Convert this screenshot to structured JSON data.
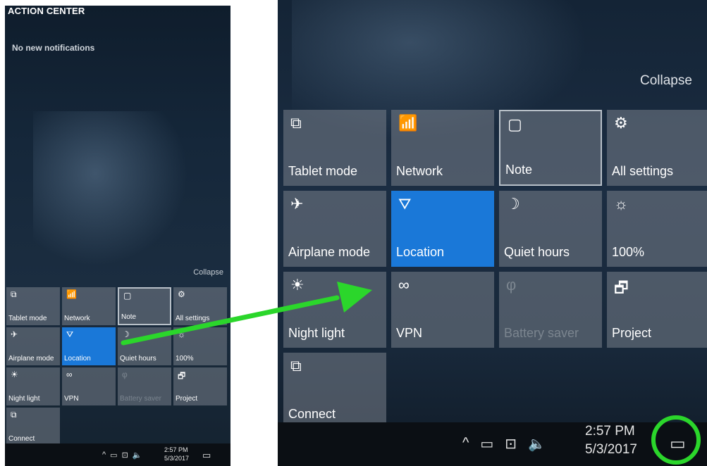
{
  "small_panel": {
    "title": "ACTION CENTER",
    "no_notifications": "No new notifications",
    "collapse_label": "Collapse",
    "tiles": [
      {
        "label": "Tablet mode",
        "icon": "tablet-mode-icon",
        "glyph": "⧉",
        "state": "normal"
      },
      {
        "label": "Network",
        "icon": "network-icon",
        "glyph": "📶",
        "state": "normal"
      },
      {
        "label": "Note",
        "icon": "note-icon",
        "glyph": "▢",
        "state": "outlined"
      },
      {
        "label": "All settings",
        "icon": "gear-icon",
        "glyph": "⚙",
        "state": "normal"
      },
      {
        "label": "Airplane mode",
        "icon": "airplane-icon",
        "glyph": "✈",
        "state": "normal"
      },
      {
        "label": "Location",
        "icon": "location-icon",
        "glyph": "⛛",
        "state": "active"
      },
      {
        "label": "Quiet hours",
        "icon": "moon-icon",
        "glyph": "☽",
        "state": "normal"
      },
      {
        "label": "100%",
        "icon": "brightness-icon",
        "glyph": "☼",
        "state": "normal"
      },
      {
        "label": "Night light",
        "icon": "night-light-icon",
        "glyph": "☀",
        "state": "normal"
      },
      {
        "label": "VPN",
        "icon": "vpn-icon",
        "glyph": "∞",
        "state": "normal"
      },
      {
        "label": "Battery saver",
        "icon": "battery-saver-icon",
        "glyph": "φ",
        "state": "disabled"
      },
      {
        "label": "Project",
        "icon": "project-icon",
        "glyph": "🗗",
        "state": "normal"
      },
      {
        "label": "Connect",
        "icon": "connect-icon",
        "glyph": "⧉",
        "state": "normal"
      }
    ],
    "taskbar": {
      "time": "2:57 PM",
      "date": "5/3/2017"
    }
  },
  "zoom_panel": {
    "collapse_label": "Collapse",
    "tiles": [
      {
        "label": "Tablet mode",
        "icon": "tablet-mode-icon",
        "glyph": "⧉",
        "state": "normal"
      },
      {
        "label": "Network",
        "icon": "network-icon",
        "glyph": "📶",
        "state": "normal"
      },
      {
        "label": "Note",
        "icon": "note-icon",
        "glyph": "▢",
        "state": "outlined"
      },
      {
        "label": "All settings",
        "icon": "gear-icon",
        "glyph": "⚙",
        "state": "normal"
      },
      {
        "label": "Airplane mode",
        "icon": "airplane-icon",
        "glyph": "✈",
        "state": "normal"
      },
      {
        "label": "Location",
        "icon": "location-icon",
        "glyph": "⛛",
        "state": "active"
      },
      {
        "label": "Quiet hours",
        "icon": "moon-icon",
        "glyph": "☽",
        "state": "normal"
      },
      {
        "label": "100%",
        "icon": "brightness-icon",
        "glyph": "☼",
        "state": "normal"
      },
      {
        "label": "Night light",
        "icon": "night-light-icon",
        "glyph": "☀",
        "state": "normal"
      },
      {
        "label": "VPN",
        "icon": "vpn-icon",
        "glyph": "∞",
        "state": "normal"
      },
      {
        "label": "Battery saver",
        "icon": "battery-saver-icon",
        "glyph": "φ",
        "state": "disabled"
      },
      {
        "label": "Project",
        "icon": "project-icon",
        "glyph": "🗗",
        "state": "normal"
      },
      {
        "label": "Connect",
        "icon": "connect-icon",
        "glyph": "⧉",
        "state": "normal"
      }
    ],
    "taskbar": {
      "time": "2:57 PM",
      "date": "5/3/2017"
    }
  },
  "tray_icons": [
    {
      "icon": "chevron-up-icon",
      "glyph": "^"
    },
    {
      "icon": "battery-icon",
      "glyph": "▭"
    },
    {
      "icon": "network-disconnected-icon",
      "glyph": "⊡"
    },
    {
      "icon": "speaker-icon",
      "glyph": "🔈"
    }
  ],
  "colors": {
    "active_tile": "#1a78d8",
    "highlight_circle": "#2bd62b",
    "arrow": "#2bd62b"
  }
}
